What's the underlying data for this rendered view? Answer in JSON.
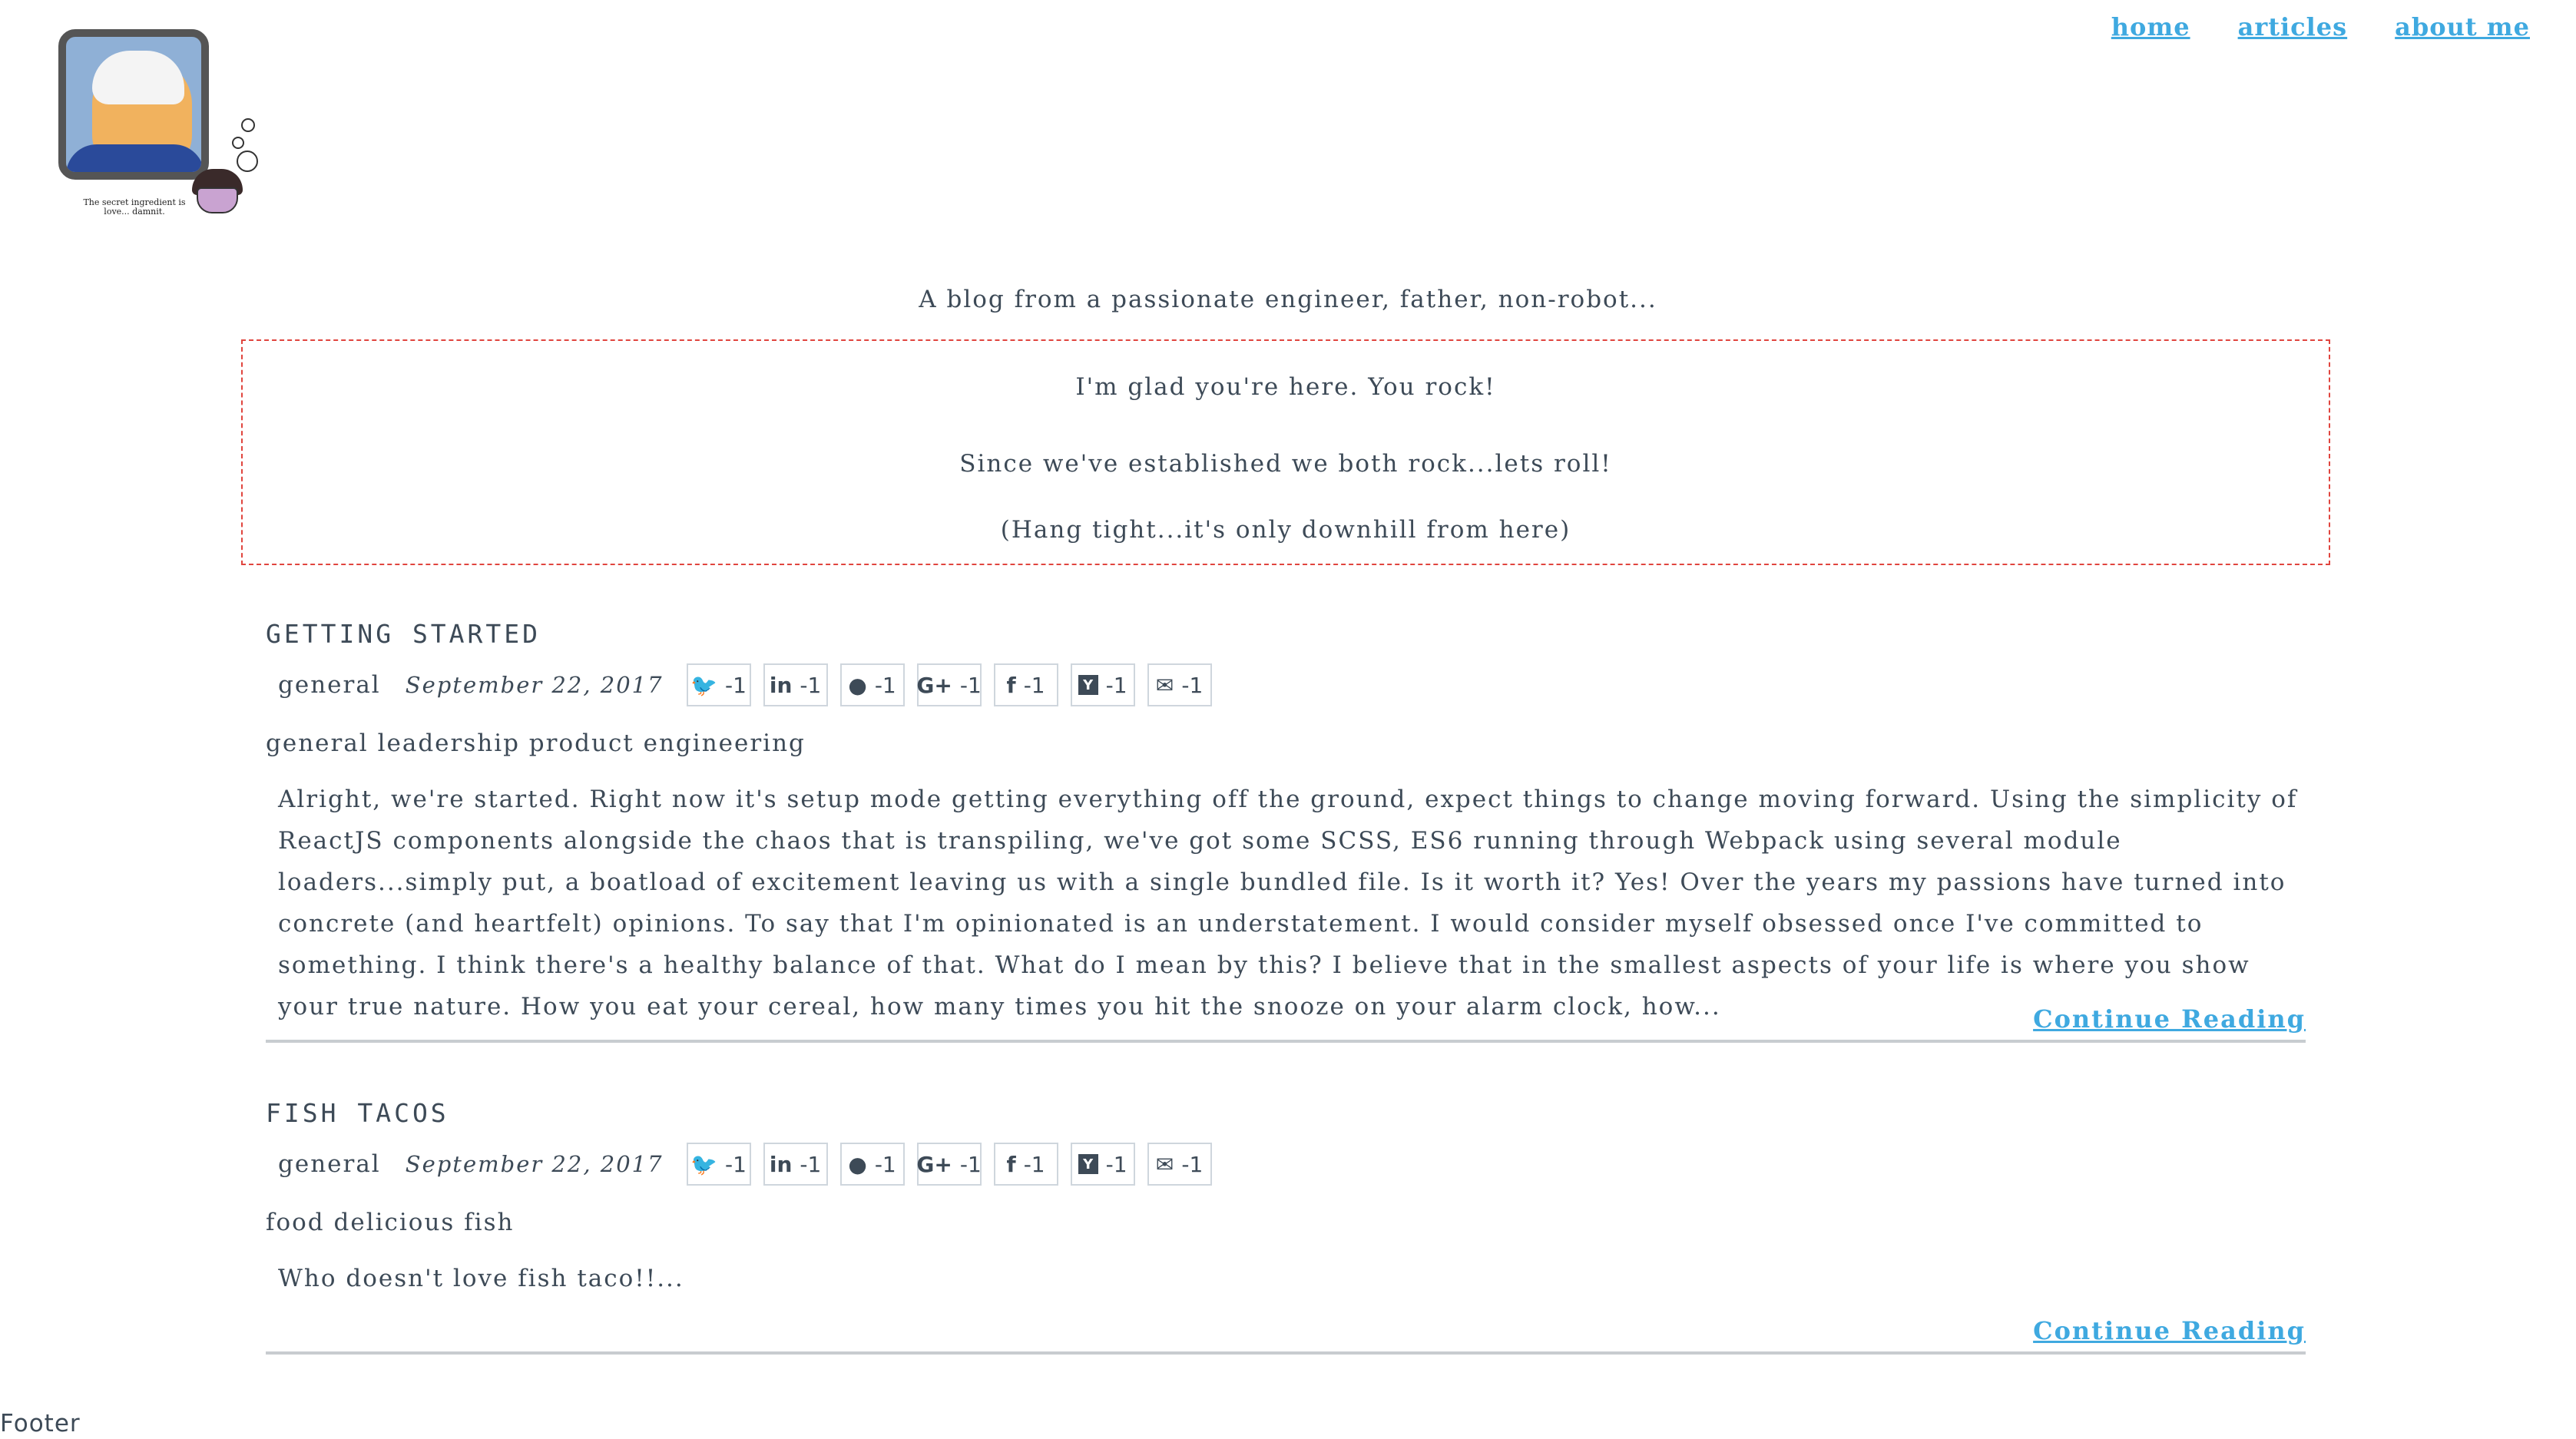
{
  "logo": {
    "caption": "The secret ingredient is love... damnit."
  },
  "nav": {
    "items": [
      {
        "label": "home"
      },
      {
        "label": "articles"
      },
      {
        "label": "about me"
      }
    ]
  },
  "tagline": "A blog from a passionate engineer, father, non-robot...",
  "welcome": {
    "line1": "I'm glad you're here. You rock!",
    "line2": "Since we've established we both rock...lets roll!",
    "line3": "(Hang tight...it's only downhill from here)"
  },
  "share_icons": [
    "twitter-icon",
    "linkedin-icon",
    "reddit-icon",
    "google-plus-icon",
    "facebook-icon",
    "hacker-news-icon",
    "email-icon"
  ],
  "posts": [
    {
      "title": "GETTING STARTED",
      "category": "general",
      "date": "September 22, 2017",
      "share_counts": [
        "-1",
        "-1",
        "-1",
        "-1",
        "-1",
        "-1",
        "-1"
      ],
      "tags": "general leadership product engineering",
      "excerpt": "Alright, we're started. Right now it's setup mode getting everything off the ground, expect things to change moving forward. Using the simplicity of ReactJS components alongside the chaos that is transpiling, we've got some SCSS, ES6 running through Webpack using several module loaders...simply put, a boatload of excitement leaving us with a single bundled file. Is it worth it? Yes! Over the years my passions have turned into concrete (and heartfelt) opinions. To say that I'm opinionated is an understatement. I would consider myself obsessed once I've committed to something. I think there's a healthy balance of that. What do I mean by this? I believe that in the smallest aspects of your life is where you show your true nature. How you eat your cereal, how many times you hit the snooze on your alarm clock, how...",
      "continue_label": "Continue Reading"
    },
    {
      "title": "FISH TACOS",
      "category": "general",
      "date": "September 22, 2017",
      "share_counts": [
        "-1",
        "-1",
        "-1",
        "-1",
        "-1",
        "-1",
        "-1"
      ],
      "tags": "food delicious fish",
      "excerpt": "Who doesn't love fish taco!!...",
      "continue_label": "Continue Reading"
    }
  ],
  "footer": "Footer"
}
